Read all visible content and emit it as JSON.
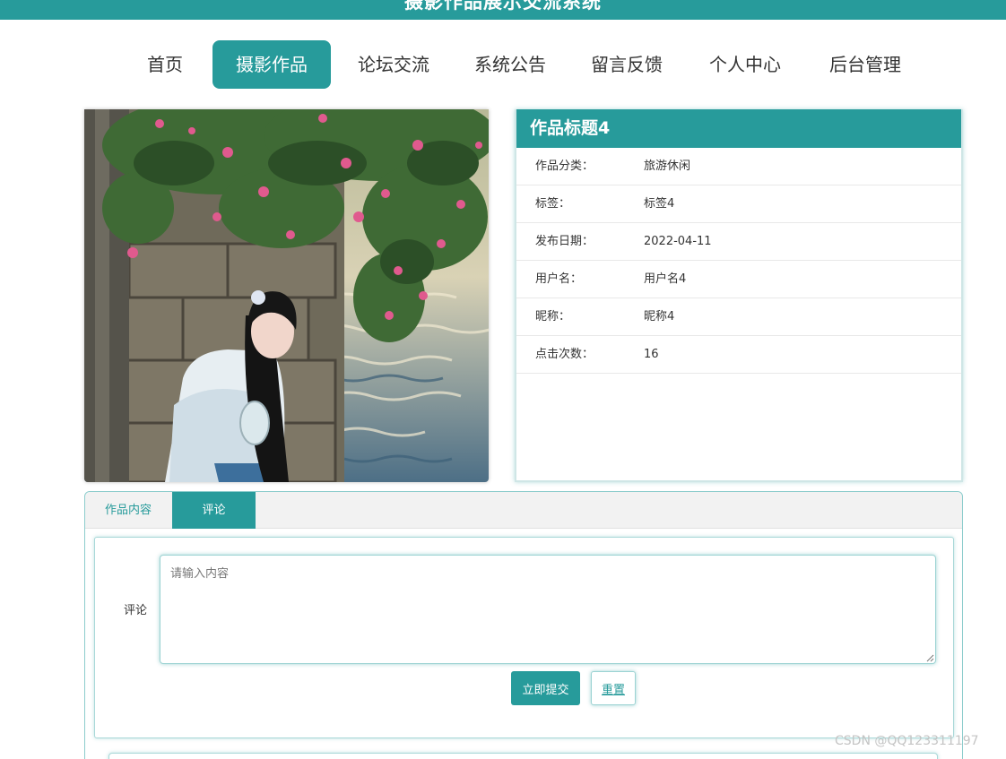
{
  "header": {
    "system_title": "摄影作品展示交流系统"
  },
  "nav": {
    "items": [
      {
        "label": "首页",
        "active": false
      },
      {
        "label": "摄影作品",
        "active": true
      },
      {
        "label": "论坛交流",
        "active": false
      },
      {
        "label": "系统公告",
        "active": false
      },
      {
        "label": "留言反馈",
        "active": false
      },
      {
        "label": "个人中心",
        "active": false
      },
      {
        "label": "后台管理",
        "active": false
      }
    ]
  },
  "work": {
    "title": "作品标题4",
    "fields": [
      {
        "label": "作品分类：",
        "value": "旅游休闲"
      },
      {
        "label": "标签：",
        "value": "标签4"
      },
      {
        "label": "发布日期：",
        "value": "2022-04-11"
      },
      {
        "label": "用户名：",
        "value": "用户名4"
      },
      {
        "label": "昵称：",
        "value": "昵称4"
      },
      {
        "label": "点击次数：",
        "value": "16"
      }
    ]
  },
  "tabs": [
    {
      "label": "作品内容",
      "active": false
    },
    {
      "label": "评论",
      "active": true
    }
  ],
  "comment_form": {
    "label": "评论",
    "placeholder": "请输入内容",
    "value": "",
    "submit_label": "立即提交",
    "reset_label": "重置"
  },
  "watermark": "CSDN @QQ123311197",
  "colors": {
    "primary": "#279b9b",
    "tab_bar": "#f2f2f2",
    "border": "#9cd3d3"
  }
}
